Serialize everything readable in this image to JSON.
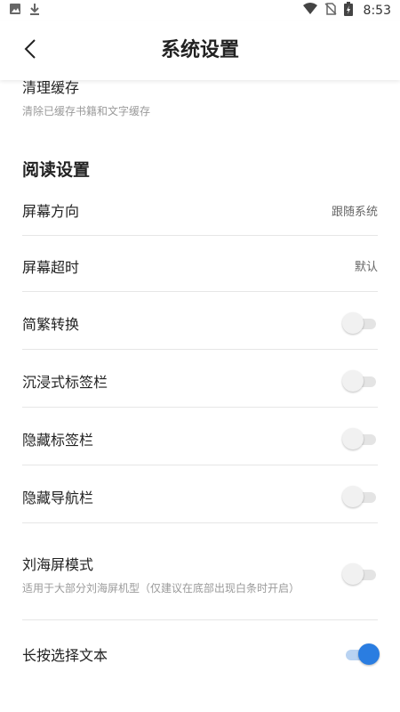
{
  "status_bar": {
    "time": "8:53",
    "icons_left": [
      "image-icon",
      "download-icon"
    ],
    "icons_right": [
      "wifi-icon",
      "no-sim-icon",
      "battery-charging-icon"
    ]
  },
  "header": {
    "title": "系统设置",
    "back_icon": "chevron-left-icon"
  },
  "cache": {
    "title": "清理缓存",
    "subtitle": "清除已缓存书籍和文字缓存"
  },
  "reading_section": {
    "title": "阅读设置",
    "rows": [
      {
        "label": "屏幕方向",
        "value": "跟随系统"
      },
      {
        "label": "屏幕超时",
        "value": "默认"
      },
      {
        "label": "简繁转换",
        "toggle": false
      },
      {
        "label": "沉浸式标签栏",
        "toggle": false
      },
      {
        "label": "隐藏标签栏",
        "toggle": false
      },
      {
        "label": "隐藏导航栏",
        "toggle": false
      },
      {
        "label": "刘海屏模式",
        "subtitle": "适用于大部分刘海屏机型（仅建议在底部出现白条时开启）",
        "toggle": false
      },
      {
        "label": "长按选择文本",
        "toggle": true
      }
    ]
  },
  "colors": {
    "accent": "#2a7de1",
    "accent_track": "#b9d3f2",
    "divider": "#e6e6e6",
    "secondary_text": "#9a9a9a"
  }
}
